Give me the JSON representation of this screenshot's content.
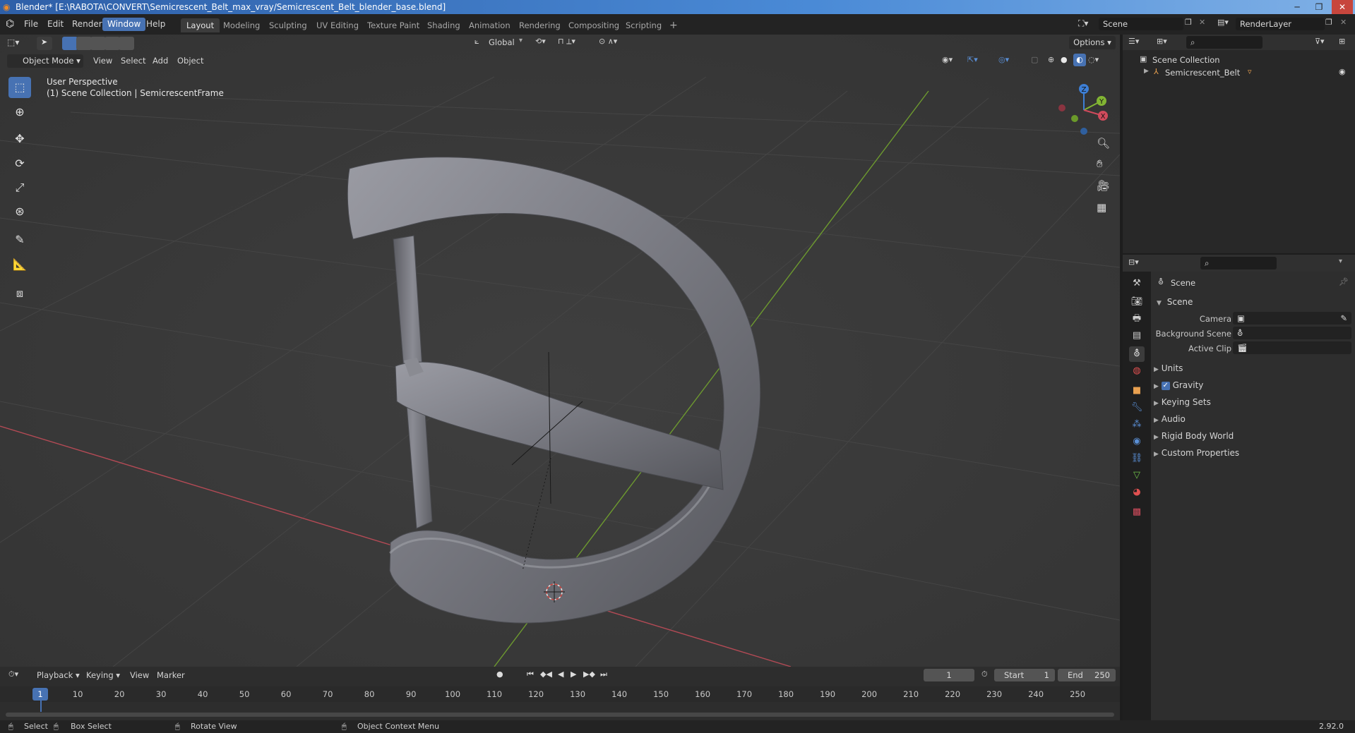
{
  "window": {
    "title": "Blender* [E:\\RABOTA\\CONVERT\\Semicrescent_Belt_max_vray/Semicrescent_Belt_blender_base.blend]"
  },
  "menubar": {
    "menus": [
      "File",
      "Edit",
      "Render",
      "Window",
      "Help"
    ],
    "active_menu": "Window",
    "workspaces": [
      "Layout",
      "Modeling",
      "Sculpting",
      "UV Editing",
      "Texture Paint",
      "Shading",
      "Animation",
      "Rendering",
      "Compositing",
      "Scripting"
    ],
    "active_workspace": "Layout",
    "add_workspace": "+",
    "scene_label": "Scene",
    "view_layer_label": "RenderLayer"
  },
  "viewport": {
    "orientation": "Global",
    "options_label": "Options",
    "mode": "Object Mode",
    "menus": [
      "View",
      "Select",
      "Add",
      "Object"
    ],
    "overlay_line1": "User Perspective",
    "overlay_line2": "(1) Scene Collection | SemicrescentFrame",
    "gizmo_axes": [
      "X",
      "Y",
      "Z"
    ],
    "colors": {
      "x_axis": "#d04b5c",
      "y_axis": "#82b533",
      "z_axis": "#3d7fd6",
      "object": "#7f8087"
    }
  },
  "outliner": {
    "root": "Scene Collection",
    "items": [
      {
        "label": "Semicrescent_Belt"
      }
    ]
  },
  "properties": {
    "context": "Scene",
    "panel": "Scene",
    "fields": [
      {
        "label": "Camera",
        "value": ""
      },
      {
        "label": "Background Scene",
        "value": ""
      },
      {
        "label": "Active Clip",
        "value": ""
      }
    ],
    "sections": [
      "Units",
      "Gravity",
      "Keying Sets",
      "Audio",
      "Rigid Body World",
      "Custom Properties"
    ],
    "gravity_checked": true
  },
  "timeline": {
    "menus": [
      "Playback",
      "Keying",
      "View",
      "Marker"
    ],
    "current_frame": "1",
    "start_label": "Start",
    "start_value": "1",
    "end_label": "End",
    "end_value": "250",
    "ticks": [
      "1",
      "10",
      "20",
      "30",
      "40",
      "50",
      "60",
      "70",
      "80",
      "90",
      "100",
      "110",
      "120",
      "130",
      "140",
      "150",
      "160",
      "170",
      "180",
      "190",
      "200",
      "210",
      "220",
      "230",
      "240",
      "250"
    ]
  },
  "statusbar": {
    "hints": [
      "Select",
      "Box Select",
      "Rotate View",
      "Object Context Menu"
    ],
    "version": "2.92.0"
  }
}
